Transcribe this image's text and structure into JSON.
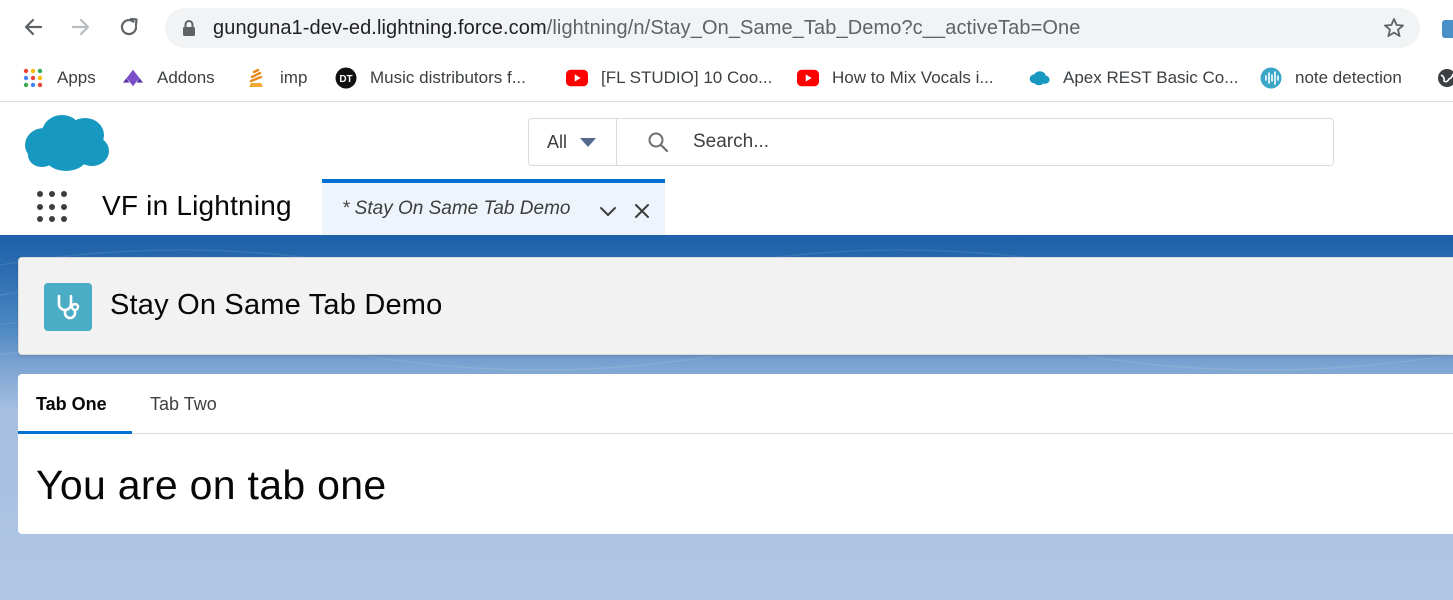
{
  "browser": {
    "url_host": "gunguna1-dev-ed.lightning.force.com",
    "url_path": "/lightning/n/Stay_On_Same_Tab_Demo?c__activeTab=One",
    "bookmarks": [
      {
        "label": "Apps",
        "icon": "apps-grid-icon"
      },
      {
        "label": "Addons",
        "icon": "addons-icon"
      },
      {
        "label": "imp",
        "icon": "imp-icon"
      },
      {
        "label": "Music distributors f...",
        "icon": "music-site-icon"
      },
      {
        "label": "[FL STUDIO] 10 Coo...",
        "icon": "youtube-icon"
      },
      {
        "label": "How to Mix Vocals i...",
        "icon": "youtube-icon"
      },
      {
        "label": "Apex REST Basic Co...",
        "icon": "salesforce-cloud-icon"
      },
      {
        "label": "note detection",
        "icon": "soundwave-icon"
      }
    ]
  },
  "header": {
    "search_scope": "All",
    "search_placeholder": "Search...",
    "app_name": "VF in Lightning",
    "nav_tab_label": "* Stay On Same Tab Demo"
  },
  "page": {
    "title": "Stay On Same Tab Demo",
    "icon": "stethoscope-icon",
    "tabs": [
      {
        "label": "Tab One",
        "active": true
      },
      {
        "label": "Tab Two",
        "active": false
      }
    ],
    "body_text": "You are on tab one"
  },
  "colors": {
    "brand_blue": "#0070d2",
    "salesforce_cloud": "#1798c1",
    "page_icon": "#4bacc6",
    "youtube_red": "#ff0000"
  }
}
